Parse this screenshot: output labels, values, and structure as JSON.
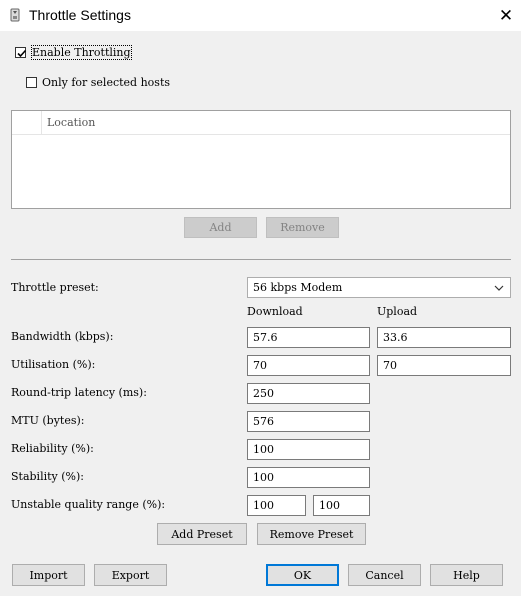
{
  "window": {
    "title": "Throttle Settings",
    "close_glyph": "✕",
    "app_icon": "fiddler-app-icon"
  },
  "throttling": {
    "enable_label": "Enable Throttling",
    "enable_checked": true,
    "selected_hosts_label": "Only for selected hosts",
    "selected_hosts_checked": false
  },
  "hosts_table": {
    "column_header": "Location",
    "rows": []
  },
  "host_buttons": {
    "add": "Add",
    "remove": "Remove"
  },
  "preset": {
    "label": "Throttle preset:",
    "selected": "56 kbps Modem"
  },
  "columns": {
    "download": "Download",
    "upload": "Upload"
  },
  "fields": {
    "bandwidth": {
      "label": "Bandwidth (kbps):",
      "download": "57.6",
      "upload": "33.6"
    },
    "utilisation": {
      "label": "Utilisation (%):",
      "download": "70",
      "upload": "70"
    },
    "latency": {
      "label": "Round-trip latency (ms):",
      "value": "250"
    },
    "mtu": {
      "label": "MTU (bytes):",
      "value": "576"
    },
    "reliability": {
      "label": "Reliability (%):",
      "value": "100"
    },
    "stability": {
      "label": "Stability (%):",
      "value": "100"
    },
    "unstable_range": {
      "label": "Unstable quality range (%):",
      "min": "100",
      "max": "100"
    }
  },
  "preset_buttons": {
    "add": "Add Preset",
    "remove": "Remove Preset"
  },
  "footer_buttons": {
    "import": "Import",
    "export": "Export",
    "ok": "OK",
    "cancel": "Cancel",
    "help": "Help"
  },
  "colors": {
    "accent": "#0078d7",
    "dialog_bg": "#f0f0f0"
  }
}
